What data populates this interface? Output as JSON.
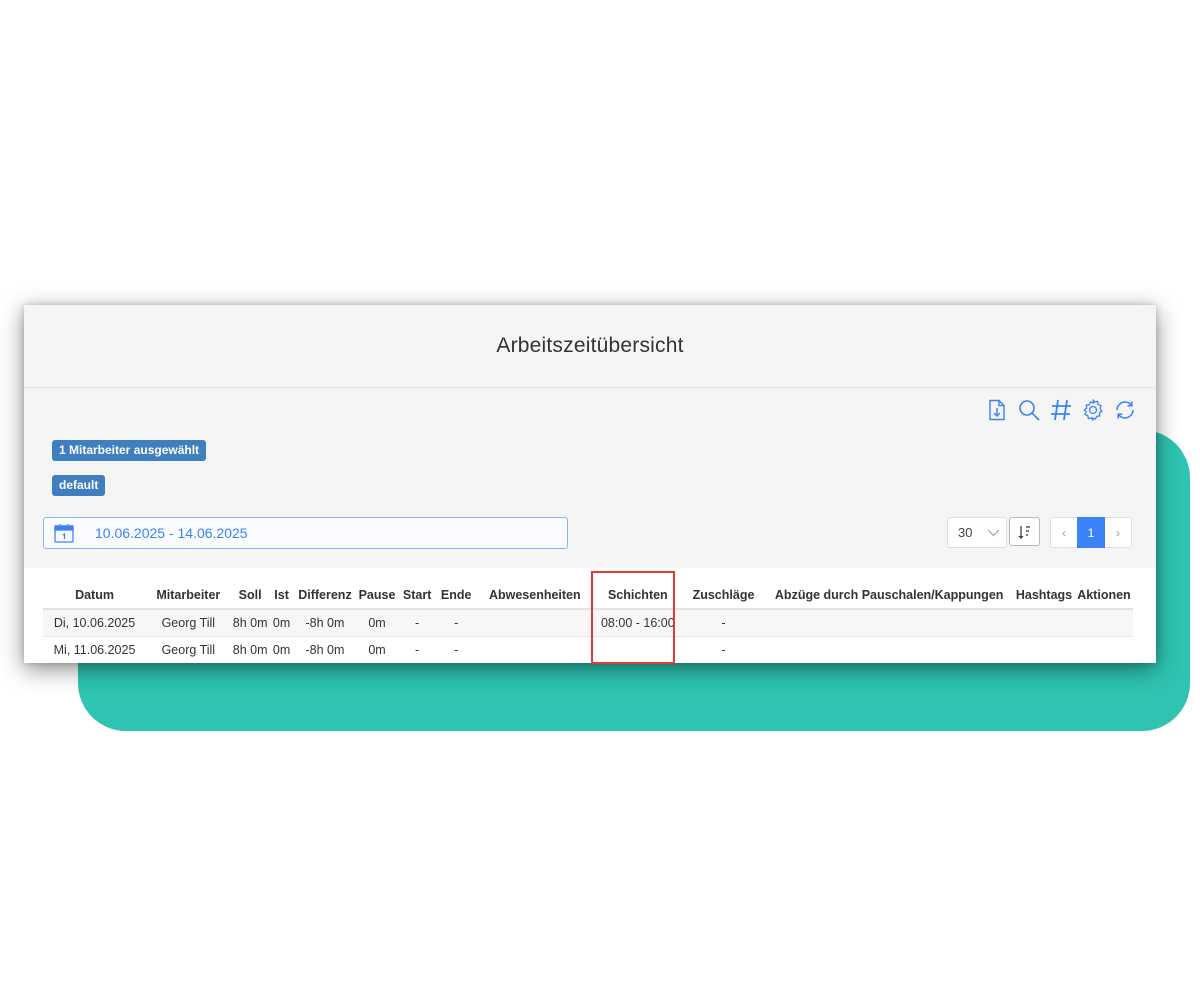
{
  "page": {
    "title": "Arbeitszeitübersicht"
  },
  "toolbar": {
    "icons": [
      "export-document-icon",
      "search-icon",
      "hashtag-icon",
      "gear-icon",
      "refresh-icon"
    ],
    "accent_color": "#3b82f6"
  },
  "badges": {
    "employees_selected": "1 Mitarbeiter ausgewählt",
    "profile": "default"
  },
  "filter": {
    "date_range": "10.06.2025 - 14.06.2025",
    "per_page": "30"
  },
  "pagination": {
    "prev": "‹",
    "current": "1",
    "next": "›"
  },
  "table": {
    "columns": [
      "Datum",
      "Mitarbeiter",
      "Soll",
      "Ist",
      "Differenz",
      "Pause",
      "Start",
      "Ende",
      "Abwesenheiten",
      "Schichten",
      "Zuschläge",
      "Abzüge durch Pauschalen/Kappungen",
      "Hashtags",
      "Aktionen"
    ],
    "rows": [
      [
        "Di, 10.06.2025",
        "Georg Till",
        "8h 0m",
        "0m",
        "-8h 0m",
        "0m",
        "-",
        "-",
        "",
        "08:00 - 16:00",
        "-",
        "",
        "",
        ""
      ],
      [
        "Mi, 11.06.2025",
        "Georg Till",
        "8h 0m",
        "0m",
        "-8h 0m",
        "0m",
        "-",
        "-",
        "",
        "",
        "-",
        "",
        "",
        ""
      ]
    ]
  },
  "colors": {
    "teal_background": "#2ec4b1",
    "badge": "#3f7fbf",
    "highlight": "#e53935"
  }
}
